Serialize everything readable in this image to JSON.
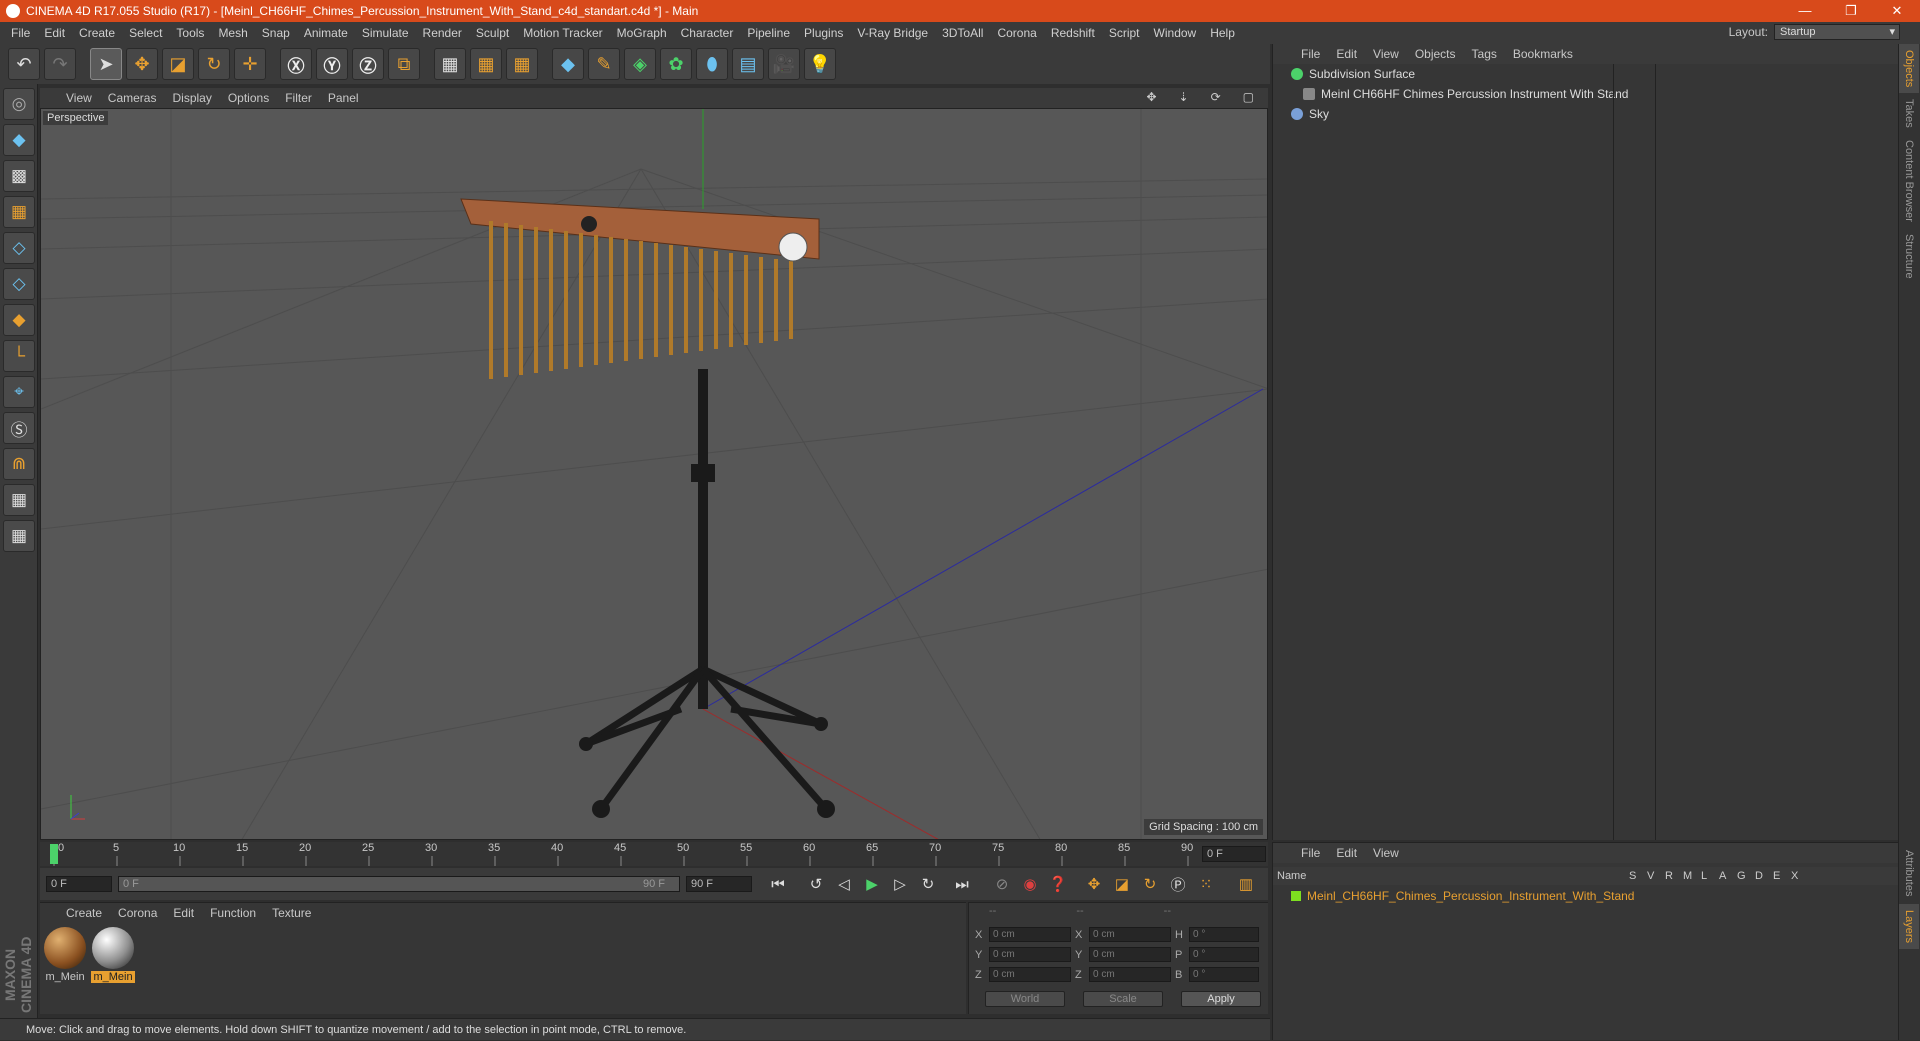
{
  "window": {
    "title": "CINEMA 4D R17.055 Studio (R17) - [Meinl_CH66HF_Chimes_Percussion_Instrument_With_Stand_c4d_standart.c4d *] - Main",
    "minimize": "—",
    "restore": "❐",
    "close": "✕"
  },
  "menubar": [
    "File",
    "Edit",
    "Create",
    "Select",
    "Tools",
    "Mesh",
    "Snap",
    "Animate",
    "Simulate",
    "Render",
    "Sculpt",
    "Motion Tracker",
    "MoGraph",
    "Character",
    "Pipeline",
    "Plugins",
    "V-Ray Bridge",
    "3DToAll",
    "Corona",
    "Redshift",
    "Script",
    "Window",
    "Help"
  ],
  "layout": {
    "label": "Layout:",
    "value": "Startup"
  },
  "viewport": {
    "menu": [
      "View",
      "Cameras",
      "Display",
      "Options",
      "Filter",
      "Panel"
    ],
    "camera_label": "Perspective",
    "grid_spacing": "Grid Spacing : 100 cm"
  },
  "timeline": {
    "ticks": [
      "0",
      "5",
      "10",
      "15",
      "20",
      "25",
      "30",
      "35",
      "40",
      "45",
      "50",
      "55",
      "60",
      "65",
      "70",
      "75",
      "80",
      "85",
      "90"
    ],
    "current_frame": "0 F",
    "start_field": "0 F",
    "range_start": "0 F",
    "range_end": "90 F",
    "end_field": "90 F"
  },
  "materials": {
    "menu": [
      "Create",
      "Corona",
      "Edit",
      "Function",
      "Texture"
    ],
    "items": [
      {
        "name": "m_Mein",
        "selected": false,
        "color": "#8a5020"
      },
      {
        "name": "m_Mein",
        "selected": true,
        "color": "#909090"
      }
    ]
  },
  "coords": {
    "headers": [
      "--",
      "--",
      "--"
    ],
    "rows": [
      {
        "a": "X",
        "av": "0 cm",
        "b": "X",
        "bv": "0 cm",
        "c": "H",
        "cv": "0 °"
      },
      {
        "a": "Y",
        "av": "0 cm",
        "b": "Y",
        "bv": "0 cm",
        "c": "P",
        "cv": "0 °"
      },
      {
        "a": "Z",
        "av": "0 cm",
        "b": "Z",
        "bv": "0 cm",
        "c": "B",
        "cv": "0 °"
      }
    ],
    "world": "World",
    "scale": "Scale",
    "apply": "Apply"
  },
  "status": "Move: Click and drag to move elements. Hold down SHIFT to quantize movement / add to the selection in point mode, CTRL to remove.",
  "objects": {
    "menu": [
      "File",
      "Edit",
      "View",
      "Objects",
      "Tags",
      "Bookmarks"
    ],
    "rows": [
      {
        "name": "Subdivision Surface",
        "color": "#4cd26a"
      },
      {
        "name": "Meinl CH66HF Chimes Percussion Instrument With Stand",
        "color": "#888888"
      },
      {
        "name": "Sky",
        "color": "#7aa0d8"
      }
    ]
  },
  "side_tabs": [
    "Objects",
    "Takes",
    "Content Browser",
    "Structure"
  ],
  "side_tabs_bottom": [
    "Attributes",
    "Layers"
  ],
  "layers": {
    "menu": [
      "File",
      "Edit",
      "View"
    ],
    "header": {
      "name": "Name",
      "cols": [
        "S",
        "V",
        "R",
        "M",
        "L",
        "A",
        "G",
        "D",
        "E",
        "X"
      ]
    },
    "row": "Meinl_CH66HF_Chimes_Percussion_Instrument_With_Stand"
  },
  "colors": {
    "accent": "#d84a1b",
    "highlight": "#e8a030"
  }
}
